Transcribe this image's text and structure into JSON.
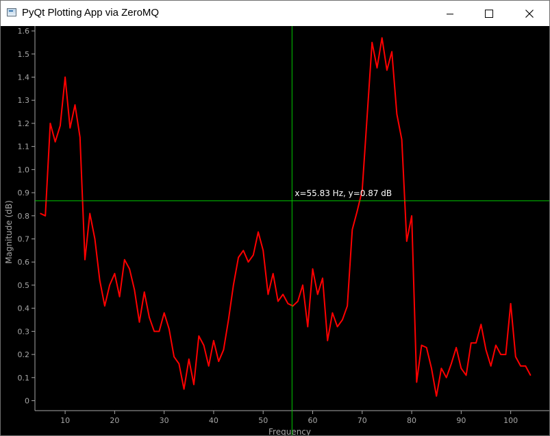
{
  "window": {
    "title": "PyQt Plotting App via ZeroMQ",
    "buttons": {
      "minimize": "minimize",
      "maximize": "maximize",
      "close": "close"
    }
  },
  "colors": {
    "background": "#000000",
    "series": "#ff0000",
    "crosshair": "#00cc00",
    "axis": "#a8a8a8"
  },
  "crosshair": {
    "label": "x=55.83 Hz, y=0.87 dB",
    "x": 55.83,
    "y": 0.865
  },
  "chart_data": {
    "type": "line",
    "title": "",
    "xlabel": "Frequency",
    "ylabel": "Magnitude (dB)",
    "xlim": [
      3.9,
      107.8
    ],
    "ylim": [
      -0.043,
      1.621
    ],
    "xticks": [
      10,
      20,
      30,
      40,
      50,
      60,
      70,
      80,
      90,
      100
    ],
    "yticks": [
      0,
      0.1,
      0.2,
      0.3,
      0.4,
      0.5,
      0.6,
      0.7,
      0.8,
      0.9,
      1.0,
      1.1,
      1.2,
      1.3,
      1.4,
      1.5,
      1.6
    ],
    "ytick_labels": [
      "0",
      "0.1",
      "0.2",
      "0.3",
      "0.4",
      "0.5",
      "0.6",
      "0.7",
      "0.8",
      "0.9",
      "1.0",
      "1.1",
      "1.2",
      "1.3",
      "1.4",
      "1.5",
      "1.6"
    ],
    "grid": false,
    "series": [
      {
        "x": [
          5,
          6,
          7,
          8,
          9,
          10,
          11,
          12,
          13,
          14,
          15,
          16,
          17,
          18,
          19,
          20,
          21,
          22,
          23,
          24,
          25,
          26,
          27,
          28,
          29,
          30,
          31,
          32,
          33,
          34,
          35,
          36,
          37,
          38,
          39,
          40,
          41,
          42,
          43,
          44,
          45,
          46,
          47,
          48,
          49,
          50,
          51,
          52,
          53,
          54,
          55,
          56,
          57,
          58,
          59,
          60,
          61,
          62,
          63,
          64,
          65,
          66,
          67,
          68,
          69,
          70,
          71,
          72,
          73,
          74,
          75,
          76,
          77,
          78,
          79,
          80,
          81,
          82,
          83,
          84,
          85,
          86,
          87,
          88,
          89,
          90,
          91,
          92,
          93,
          94,
          95,
          96,
          97,
          98,
          99,
          100,
          101,
          102,
          103,
          104
        ],
        "y": [
          0.81,
          0.8,
          1.2,
          1.12,
          1.19,
          1.4,
          1.18,
          1.28,
          1.14,
          0.61,
          0.81,
          0.7,
          0.52,
          0.41,
          0.5,
          0.55,
          0.45,
          0.61,
          0.57,
          0.48,
          0.34,
          0.47,
          0.36,
          0.3,
          0.3,
          0.38,
          0.31,
          0.19,
          0.16,
          0.05,
          0.18,
          0.07,
          0.28,
          0.24,
          0.15,
          0.26,
          0.17,
          0.22,
          0.35,
          0.5,
          0.62,
          0.65,
          0.6,
          0.63,
          0.73,
          0.65,
          0.46,
          0.55,
          0.43,
          0.46,
          0.42,
          0.41,
          0.43,
          0.5,
          0.32,
          0.57,
          0.46,
          0.53,
          0.26,
          0.38,
          0.32,
          0.35,
          0.41,
          0.74,
          0.82,
          0.91,
          1.23,
          1.55,
          1.44,
          1.57,
          1.43,
          1.51,
          1.24,
          1.13,
          0.69,
          0.8,
          0.08,
          0.24,
          0.23,
          0.14,
          0.02,
          0.14,
          0.1,
          0.16,
          0.23,
          0.14,
          0.11,
          0.25,
          0.25,
          0.33,
          0.22,
          0.15,
          0.24,
          0.2,
          0.2,
          0.42,
          0.19,
          0.15,
          0.15,
          0.11
        ]
      }
    ]
  }
}
